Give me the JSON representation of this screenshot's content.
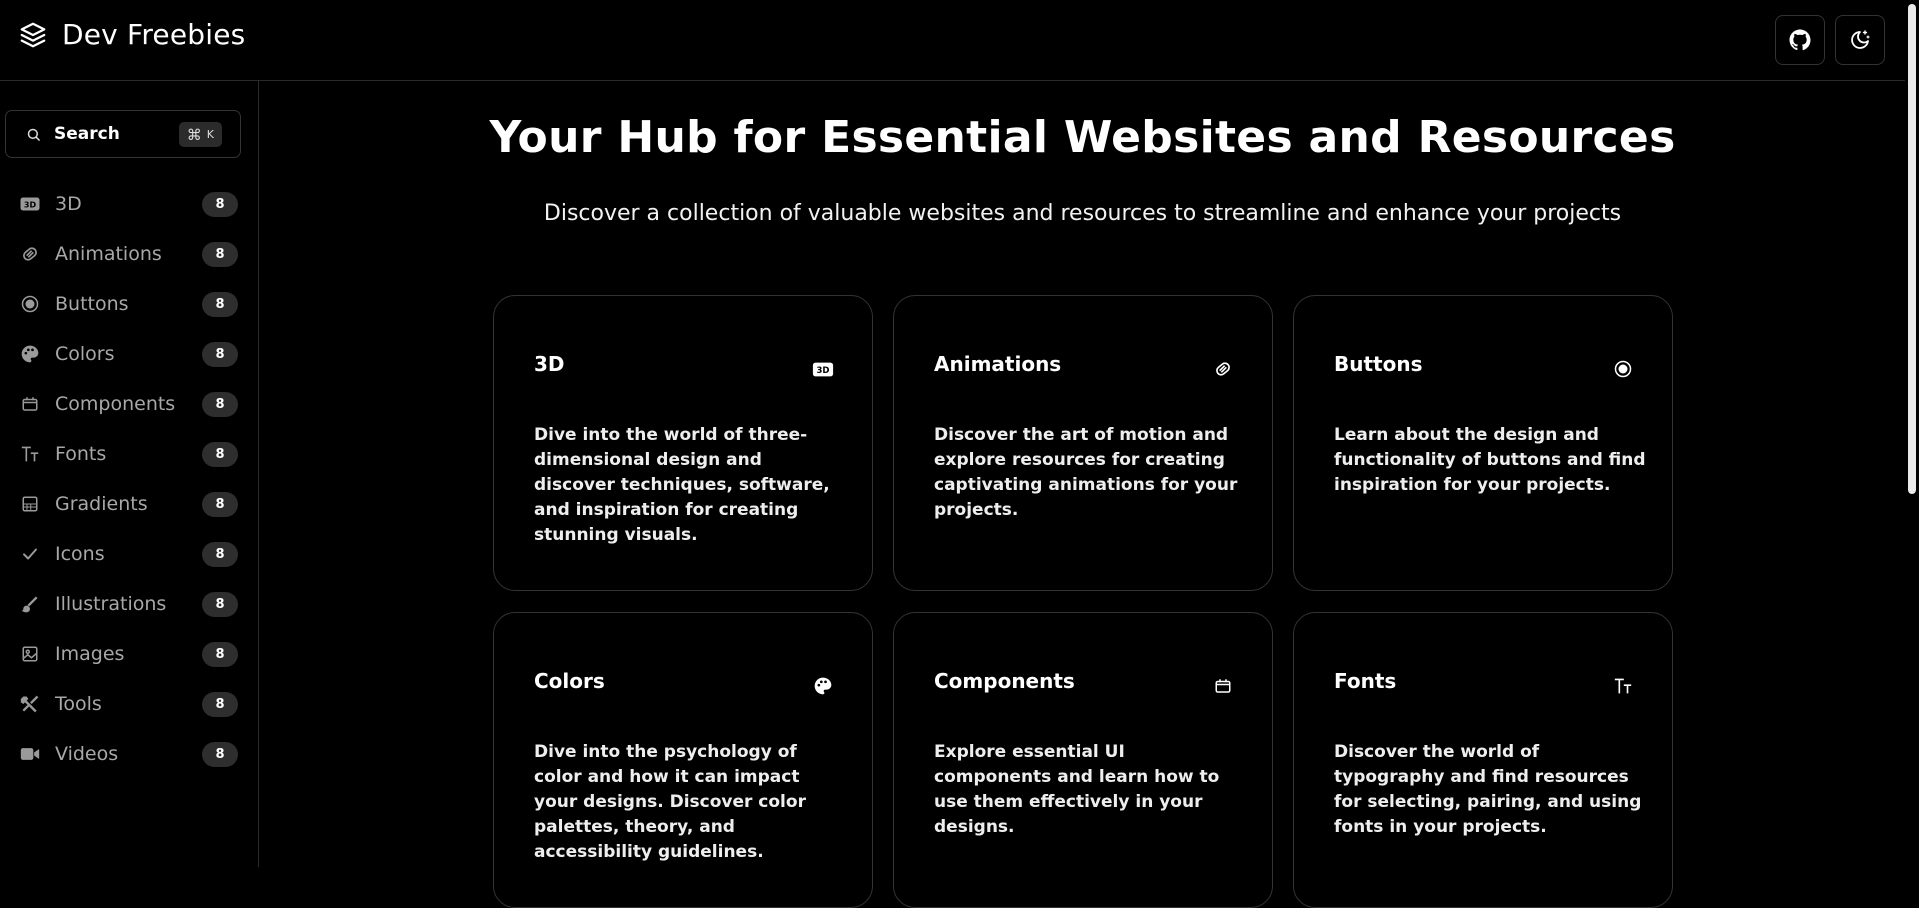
{
  "header": {
    "brand": "Dev Freebies",
    "github_label": "",
    "theme_label": ""
  },
  "search": {
    "label": "Search",
    "shortcut_symbol": "⌘",
    "shortcut_key": "K"
  },
  "sidebar": {
    "items": [
      {
        "label": "3D",
        "count": "8",
        "icon": "3d-icon"
      },
      {
        "label": "Animations",
        "count": "8",
        "icon": "animation-icon"
      },
      {
        "label": "Buttons",
        "count": "8",
        "icon": "button-icon"
      },
      {
        "label": "Colors",
        "count": "8",
        "icon": "palette-icon"
      },
      {
        "label": "Components",
        "count": "8",
        "icon": "component-icon"
      },
      {
        "label": "Fonts",
        "count": "8",
        "icon": "fonts-icon"
      },
      {
        "label": "Gradients",
        "count": "8",
        "icon": "gradient-icon"
      },
      {
        "label": "Icons",
        "count": "8",
        "icon": "check-icon"
      },
      {
        "label": "Illustrations",
        "count": "8",
        "icon": "brush-icon"
      },
      {
        "label": "Images",
        "count": "8",
        "icon": "image-icon"
      },
      {
        "label": "Tools",
        "count": "8",
        "icon": "tools-icon"
      },
      {
        "label": "Videos",
        "count": "8",
        "icon": "video-icon"
      }
    ]
  },
  "hero": {
    "title": "Your Hub for Essential Websites and Resources",
    "subtitle": "Discover a collection of valuable websites and resources to streamline and enhance your projects"
  },
  "cards": [
    {
      "title": "3D",
      "icon": "3d-icon",
      "description": "Dive into the world of three-dimensional design and discover techniques, software, and inspiration for creating stunning visuals."
    },
    {
      "title": "Animations",
      "icon": "animation-icon",
      "description": "Discover the art of motion and explore resources for creating captivating animations for your projects."
    },
    {
      "title": "Buttons",
      "icon": "button-icon",
      "description": "Learn about the design and functionality of buttons and find inspiration for your projects."
    },
    {
      "title": "Colors",
      "icon": "palette-icon",
      "description": "Dive into the psychology of color and how it can impact your designs. Discover color palettes, theory, and accessibility guidelines."
    },
    {
      "title": "Components",
      "icon": "component-icon",
      "description": "Explore essential UI components and learn how to use them effectively in your designs."
    },
    {
      "title": "Fonts",
      "icon": "fonts-icon",
      "description": "Discover the world of typography and find resources for selecting, pairing, and using fonts in your projects."
    }
  ],
  "colors": {
    "background": "#000000",
    "border": "#333333",
    "muted_text": "#a8a8a8",
    "badge_bg": "#2e2e2e"
  }
}
